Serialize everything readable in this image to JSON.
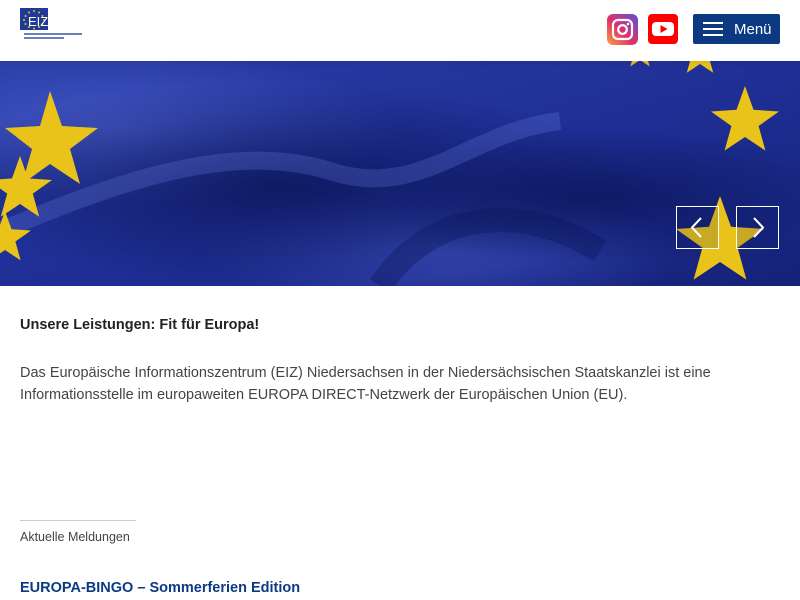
{
  "header": {
    "logo_text": "EIZ",
    "logo_subtext": "Europäisches Informationszentrum Niedersachsen",
    "menu_label": "Menü"
  },
  "colors": {
    "brand_blue": "#0b3a82",
    "eu_blue": "#1e2f9a",
    "eu_star_yellow": "#f2c100",
    "youtube_red": "#ff0000"
  },
  "icons": {
    "instagram": "instagram-icon",
    "youtube": "youtube-icon",
    "menu": "hamburger-icon",
    "prev": "chevron-left-icon",
    "next": "chevron-right-icon"
  },
  "intro": {
    "title": "Unsere Leistungen: Fit für Europa!",
    "text": "Das Europäische Informationszentrum (EIZ) Niedersachsen in der Niedersächsischen Staatskanzlei ist eine Informationsstelle im europaweiten EUROPA DIRECT-Netzwerk der Europäischen Union (EU)."
  },
  "news": {
    "tab_label": "Aktuelle Meldungen",
    "items": [
      {
        "title": "EUROPA-BINGO – Sommerferien Edition"
      }
    ]
  }
}
